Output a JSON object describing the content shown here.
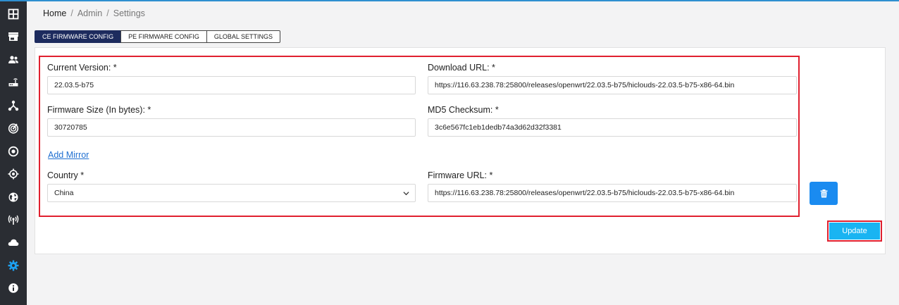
{
  "breadcrumb": {
    "home": "Home",
    "separator": "/",
    "admin": "Admin",
    "settings": "Settings"
  },
  "tabs": [
    {
      "label": "CE FIRMWARE CONFIG",
      "active": true
    },
    {
      "label": "PE FIRMWARE CONFIG",
      "active": false
    },
    {
      "label": "GLOBAL SETTINGS",
      "active": false
    }
  ],
  "form": {
    "current_version": {
      "label": "Current Version: *",
      "value": "22.03.5-b75"
    },
    "download_url": {
      "label": "Download URL: *",
      "value": "https://116.63.238.78:25800/releases/openwrt/22.03.5-b75/hiclouds-22.03.5-b75-x86-64.bin"
    },
    "firmware_size": {
      "label": "Firmware Size (In bytes): *",
      "value": "30720785"
    },
    "md5_checksum": {
      "label": "MD5 Checksum: *",
      "value": "3c6e567fc1eb1dedb74a3d62d32f3381"
    },
    "add_mirror": "Add Mirror",
    "country": {
      "label": "Country *",
      "value": "China"
    },
    "firmware_url": {
      "label": "Firmware URL: *",
      "value": "https://116.63.238.78:25800/releases/openwrt/22.03.5-b75/hiclouds-22.03.5-b75-x86-64.bin"
    }
  },
  "buttons": {
    "update": "Update"
  },
  "sidebar_icons": [
    "grid-icon",
    "store-icon",
    "users-icon",
    "router-icon",
    "network-icon",
    "radar-icon",
    "target-icon",
    "crosshair-icon",
    "globe-icon",
    "antenna-icon",
    "cloud-icon",
    "gear-icon",
    "info-icon"
  ],
  "colors": {
    "sidebar_bg": "#2a2d33",
    "active_tab": "#1d2b5e",
    "highlight_border": "#e0202f",
    "update_button": "#19b4f2",
    "delete_button": "#1a8bf0",
    "link": "#1f6fd1",
    "active_sidebar_icon": "#1da1f2"
  }
}
